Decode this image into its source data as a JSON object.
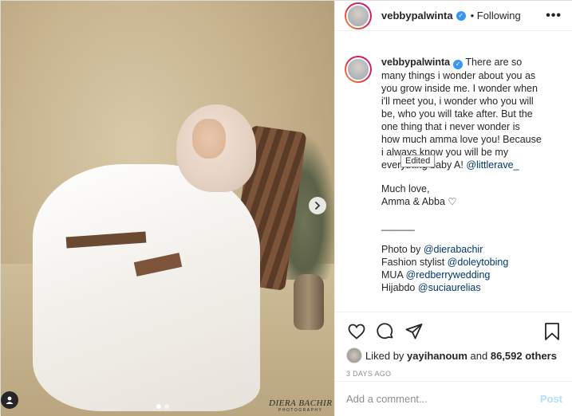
{
  "header": {
    "username": "vebbypalwinta",
    "separator": "•",
    "follow_status": "Following",
    "more": "•••"
  },
  "photo": {
    "watermark_name": "DIERA BACHIR",
    "watermark_sub": "PHOTOGRAPHY",
    "carousel_next": "›",
    "slides_total": 2,
    "slide_active": 1
  },
  "caption": {
    "username": "vebbypalwinta",
    "lines": [
      "There are so",
      "many things i wonder about you as",
      "you grow inside me. I wonder when",
      "i'll meet you, i wonder who you will",
      "be, who you will take after. But the",
      "one thing that i never wonder is",
      "how much amma love you! Because",
      "i always know you will be my",
      "everything baby A!"
    ],
    "mention_1": "@littlerave_",
    "edited_tooltip": "Edited",
    "love_1": "Much love,",
    "love_2": "Amma & Abba ♡",
    "divider": "______",
    "credits": [
      {
        "label": "Photo by ",
        "mention": "@dierabachir"
      },
      {
        "label": "Fashion stylist ",
        "mention": "@doleytobing"
      },
      {
        "label": "MUA ",
        "mention": "@redberrywedding"
      },
      {
        "label": "Hijabdo ",
        "mention": "@suciaurelias"
      }
    ]
  },
  "actions": {
    "like_icon": "heart-icon",
    "comment_icon": "comment-icon",
    "share_icon": "share-icon",
    "save_icon": "bookmark-icon",
    "liked_by_prefix": "Liked by ",
    "liked_by_user": "yayihanoum",
    "liked_by_mid": " and ",
    "liked_by_count": "86,592 others",
    "timestamp": "3 DAYS AGO"
  },
  "comment_box": {
    "placeholder": "Add a comment...",
    "post_label": "Post"
  },
  "colors": {
    "verified": "#3897f0",
    "mention": "#00376b",
    "post_disabled": "#b2dffc"
  }
}
